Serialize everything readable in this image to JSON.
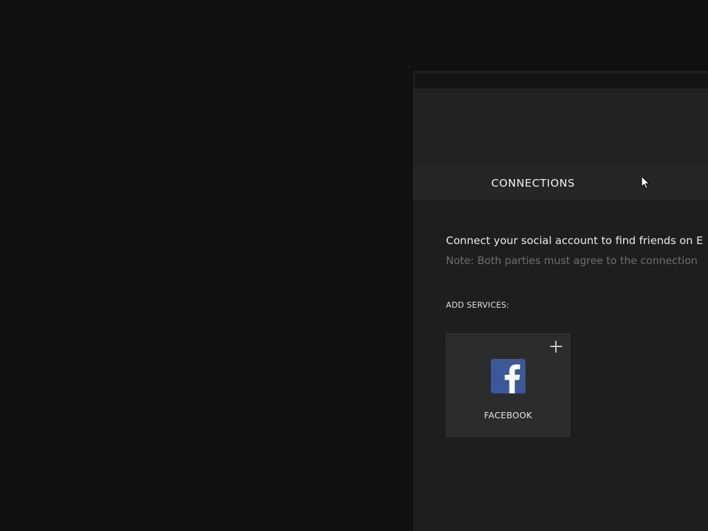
{
  "tabs": {
    "connections_label": "CONNECTIONS"
  },
  "connections": {
    "intro_text": "Connect your social account to find friends on E",
    "note_text": "Note: Both parties must agree to the connection",
    "add_services_label": "ADD SERVICES:",
    "services": [
      {
        "name": "FACEBOOK",
        "icon": "facebook-icon",
        "action_icon": "plus-icon"
      }
    ]
  },
  "colors": {
    "background": "#111111",
    "panel": "#1e1e1e",
    "card": "#2c2c2c",
    "facebook_brand": "#3b5998"
  }
}
